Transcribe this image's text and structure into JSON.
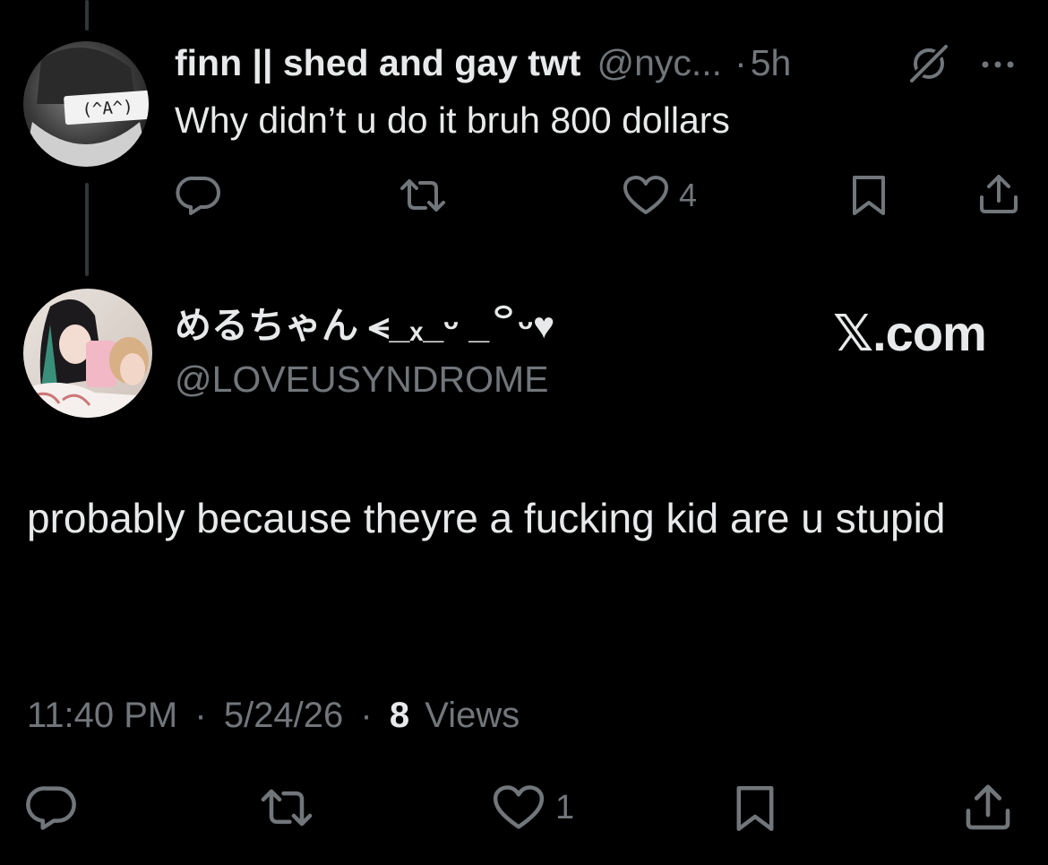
{
  "parent_tweet": {
    "display_name": "finn || shed and gay twt",
    "handle": "@nyc...",
    "separator": "·",
    "time": "5h",
    "text": "Why didn’t u do it bruh 800 dollars",
    "likes": "4",
    "avatar_text": "(^A^)"
  },
  "main_tweet": {
    "display_name": "めるちゃん ⪪_ₓ_ᵕ _꒪ᵕ♥",
    "handle": "@LOVEUSYNDROME",
    "watermark": "𝕏.com",
    "text": "probably because theyre a fucking kid are u stupid",
    "time": "11:40 PM",
    "sep1": "·",
    "date": "5/24/26",
    "sep2": "·",
    "views_count": "8",
    "views_label": "Views",
    "likes": "1"
  },
  "colors": {
    "background": "#000000",
    "primary_text": "#e7e9ea",
    "secondary_text": "#71767b",
    "icon": "#71767b",
    "thread_line": "#333639"
  },
  "icons": [
    "reply-icon",
    "retweet-icon",
    "like-icon",
    "bookmark-icon",
    "share-icon",
    "grok-icon",
    "more-icon"
  ]
}
